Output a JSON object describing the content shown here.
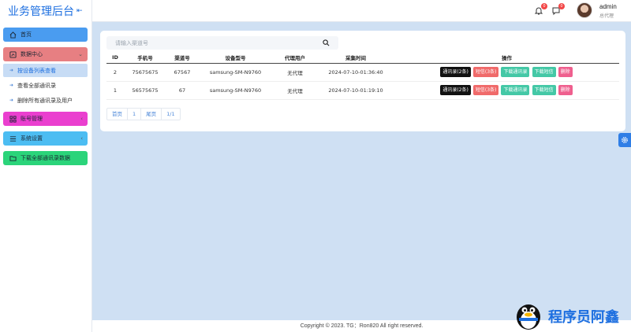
{
  "app": {
    "title": "业务管理后台",
    "collapse_icon": "collapse-icon"
  },
  "sidebar": {
    "home": "首页",
    "data_center": "数据中心",
    "data_sub": [
      "按设备列表查看",
      "查看全部通讯录",
      "删除所有通讯录及用户"
    ],
    "account": "账号管理",
    "system": "系统设置",
    "download_all": "下载全部通讯录数据"
  },
  "topbar": {
    "bell_badge": "0",
    "msg_badge": "0",
    "user_name": "admin",
    "user_role": "总代理"
  },
  "search": {
    "placeholder": "请输入渠道号"
  },
  "table": {
    "headers": [
      "ID",
      "手机号",
      "渠道号",
      "设备型号",
      "代理用户",
      "采集时间",
      "操作"
    ],
    "rows": [
      {
        "id": "2",
        "phone": "75675675",
        "channel": "67567",
        "device": "samsung-SM-N9760",
        "agent": "无代理",
        "time": "2024-07-10-01:36:40",
        "contacts_btn": "通讯录(2条)",
        "sms_btn": "短信(3条)",
        "dl_contacts_btn": "下载通讯录",
        "dl_sms_btn": "下载短信",
        "delete_btn": "删除"
      },
      {
        "id": "1",
        "phone": "56575675",
        "channel": "67",
        "device": "samsung-SM-N9760",
        "agent": "无代理",
        "time": "2024-07-10-01:19:10",
        "contacts_btn": "通讯录(2条)",
        "sms_btn": "短信(3条)",
        "dl_contacts_btn": "下载通讯录",
        "dl_sms_btn": "下载短信",
        "delete_btn": "删除"
      }
    ]
  },
  "pager": {
    "first": "首页",
    "current": "1",
    "last": "尾页",
    "info": "1/1"
  },
  "footer": {
    "text": "Copyright © 2023. TG：Ron820 All right reserved."
  },
  "watermark": {
    "text": "程序员阿鑫"
  },
  "colors": {
    "accent": "#1d6fe0",
    "home": "#4a9cf0",
    "data": "#e77f82",
    "account": "#ea3fcf",
    "system": "#4cbdf2",
    "download": "#2bd47a"
  }
}
